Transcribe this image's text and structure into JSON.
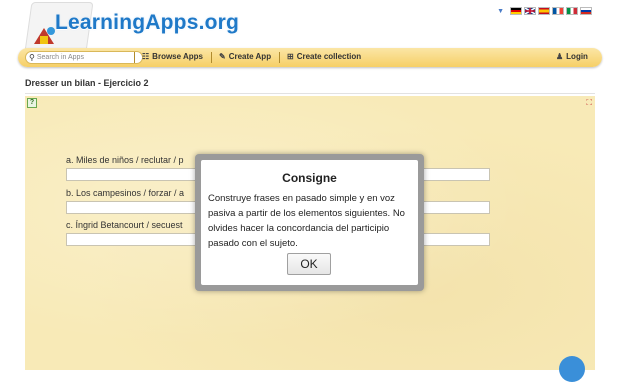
{
  "header": {
    "logo_text": "LearningApps.org",
    "flags": [
      "de",
      "gb",
      "es",
      "fr",
      "it",
      "ru"
    ]
  },
  "nav": {
    "search_placeholder": "Search in Apps",
    "browse_label": "Browse Apps",
    "create_label": "Create App",
    "collection_label": "Create collection",
    "login_label": "Login"
  },
  "page": {
    "title": "Dresser un bilan - Ejercicio 2"
  },
  "exercise": {
    "questions": [
      {
        "label": "a. Miles de niños / reclutar / p"
      },
      {
        "label": "b. Los campesinos / forzar / a"
      },
      {
        "label": "c. Íngrid Betancourt / secuest"
      }
    ]
  },
  "modal": {
    "title": "Consigne",
    "text": "Construye frases en pasado simple y en voz pasiva a partir de los elementos siguientes. No olvides hacer la concordancia del participio pasado con el sujeto.",
    "ok_label": "OK"
  },
  "colors": {
    "brand_blue": "#1f79c8",
    "nav_yellow": "#f6cf66",
    "app_background": "#f8eab7"
  }
}
